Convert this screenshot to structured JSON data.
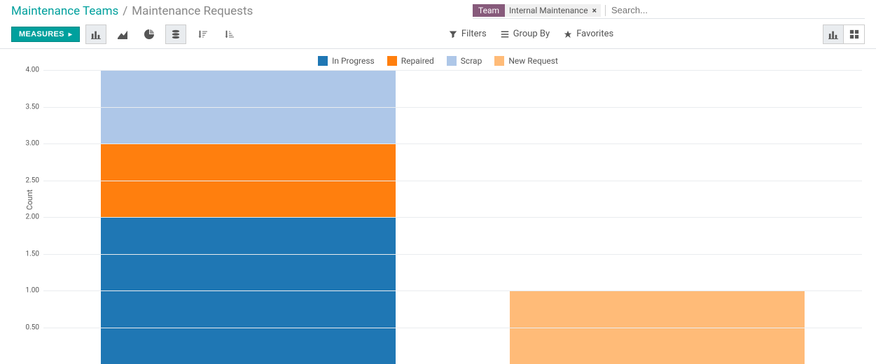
{
  "breadcrumb": {
    "parent": "Maintenance Teams",
    "sep": "/",
    "current": "Maintenance Requests"
  },
  "search": {
    "facet_key": "Team",
    "facet_value": "Internal Maintenance",
    "placeholder": "Search..."
  },
  "toolbar": {
    "measures": "Measures"
  },
  "filters": {
    "filters": "Filters",
    "groupby": "Group By",
    "favorites": "Favorites"
  },
  "chart_data": {
    "type": "bar",
    "stacked": true,
    "ylabel": "Count",
    "ylim": [
      0,
      4
    ],
    "yticks": [
      0.5,
      1.0,
      1.5,
      2.0,
      2.5,
      3.0,
      3.5,
      4.0
    ],
    "categories": [
      "",
      ""
    ],
    "series": [
      {
        "name": "In Progress",
        "color": "#1f77b4",
        "values": [
          2,
          0
        ]
      },
      {
        "name": "Repaired",
        "color": "#ff7f0e",
        "values": [
          1,
          0
        ]
      },
      {
        "name": "Scrap",
        "color": "#aec7e8",
        "values": [
          1,
          0
        ]
      },
      {
        "name": "New Request",
        "color": "#ffbb78",
        "values": [
          0,
          1
        ]
      }
    ]
  }
}
